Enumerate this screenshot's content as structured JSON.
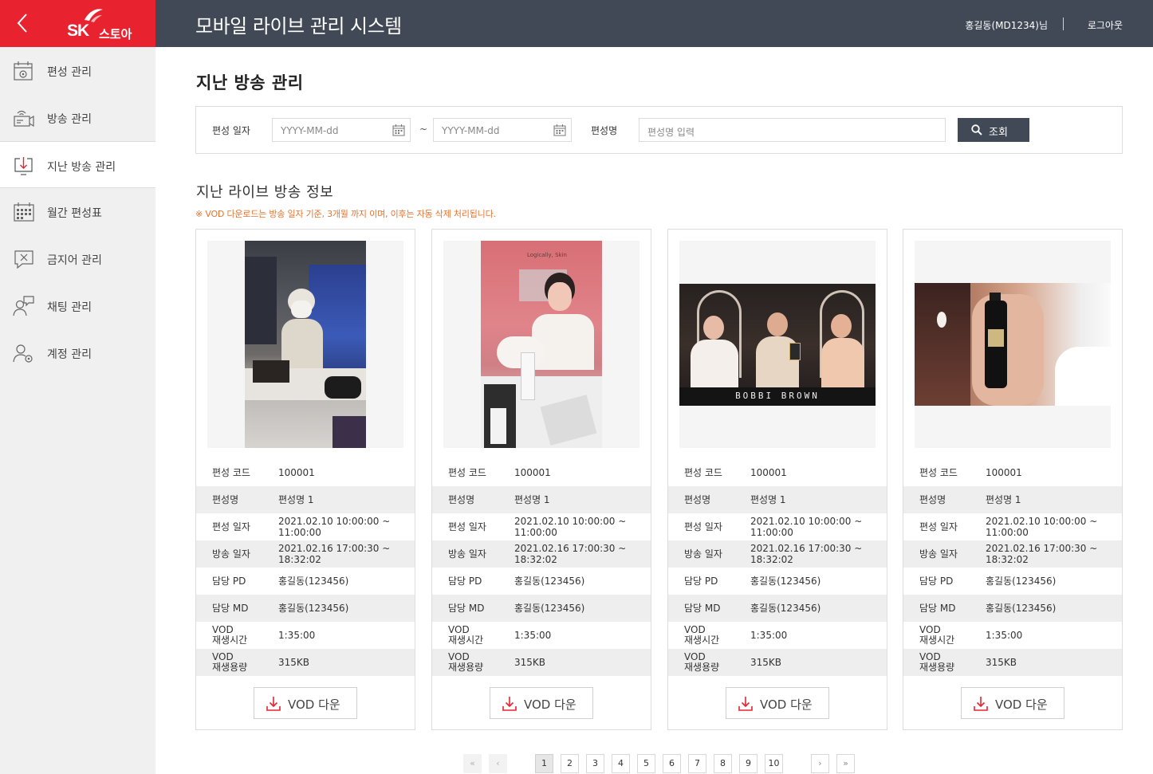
{
  "header": {
    "brand_sk": "SK",
    "brand_store": "스토아",
    "system_title": "모바일 라이브 관리 시스템",
    "user": "홍길동(MD1234)님",
    "logout": "로그아웃"
  },
  "sidebar": {
    "items": [
      {
        "label": "편성 관리",
        "icon": "calendar-gear-icon",
        "active": false
      },
      {
        "label": "방송 관리",
        "icon": "broadcast-icon",
        "active": false
      },
      {
        "label": "지난 방송 관리",
        "icon": "download-monitor-icon",
        "active": true
      },
      {
        "label": "월간 편성표",
        "icon": "calendar-grid-icon",
        "active": false
      },
      {
        "label": "금지어 관리",
        "icon": "banned-word-icon",
        "active": false
      },
      {
        "label": "채팅 관리",
        "icon": "chat-user-icon",
        "active": false
      },
      {
        "label": "계정 관리",
        "icon": "user-gear-icon",
        "active": false
      }
    ]
  },
  "page": {
    "title": "지난 방송 관리",
    "search": {
      "date_label": "편성 일자",
      "date_from_placeholder": "YYYY-MM-dd",
      "tilde": "~",
      "date_to_placeholder": "YYYY-MM-dd",
      "name_label": "편성명",
      "name_placeholder": "편성명 입력",
      "button": "조회"
    },
    "section_title": "지난 라이브 방송 정보",
    "notice": "※ VOD 다운로드는 방송 일자 기준, 3개월 까지 이며, 이후는 자동 삭제 처리됩니다."
  },
  "card_labels": {
    "code": "편성 코드",
    "name": "편성명",
    "schedule_date": "편성 일자",
    "broadcast_date": "방송 일자",
    "pd": "담당 PD",
    "md": "담당 MD",
    "vod_time_1": "VOD",
    "vod_time_2": "재생시간",
    "vod_size_1": "VOD",
    "vod_size_2": "재생용량",
    "download": "VOD 다운"
  },
  "cards": [
    {
      "code": "100001",
      "name": "편성명 1",
      "schedule_1": "2021.02.10 10:00:00 ~",
      "schedule_2": "11:00:00",
      "broadcast_1": "2021.02.16 17:00:30 ~",
      "broadcast_2": "18:32:02",
      "pd": "홍길동(123456)",
      "md": "홍길동(123456)",
      "vod_time": "1:35:00",
      "vod_size": "315KB"
    },
    {
      "code": "100001",
      "name": "편성명 1",
      "schedule_1": "2021.02.10 10:00:00 ~",
      "schedule_2": "11:00:00",
      "broadcast_1": "2021.02.16 17:00:30 ~",
      "broadcast_2": "18:32:02",
      "pd": "홍길동(123456)",
      "md": "홍길동(123456)",
      "vod_time": "1:35:00",
      "vod_size": "315KB",
      "thumb_text": "Logically, Skin"
    },
    {
      "code": "100001",
      "name": "편성명 1",
      "schedule_1": "2021.02.10 10:00:00 ~",
      "schedule_2": "11:00:00",
      "broadcast_1": "2021.02.16 17:00:30 ~",
      "broadcast_2": "18:32:02",
      "pd": "홍길동(123456)",
      "md": "홍길동(123456)",
      "vod_time": "1:35:00",
      "vod_size": "315KB",
      "thumb_text": "BOBBI BROWN"
    },
    {
      "code": "100001",
      "name": "편성명 1",
      "schedule_1": "2021.02.10 10:00:00 ~",
      "schedule_2": "11:00:00",
      "broadcast_1": "2021.02.16 17:00:30 ~",
      "broadcast_2": "18:32:02",
      "pd": "홍길동(123456)",
      "md": "홍길동(123456)",
      "vod_time": "1:35:00",
      "vod_size": "315KB"
    }
  ],
  "pagination": {
    "first": "«",
    "prev": "‹",
    "pages": [
      "1",
      "2",
      "3",
      "4",
      "5",
      "6",
      "7",
      "8",
      "9",
      "10"
    ],
    "current": "1",
    "next": "›",
    "last": "»"
  },
  "colors": {
    "brand_red": "#e8232f",
    "header_dark": "#414856",
    "notice_orange": "#e8732f",
    "download_red": "#e8232f"
  }
}
